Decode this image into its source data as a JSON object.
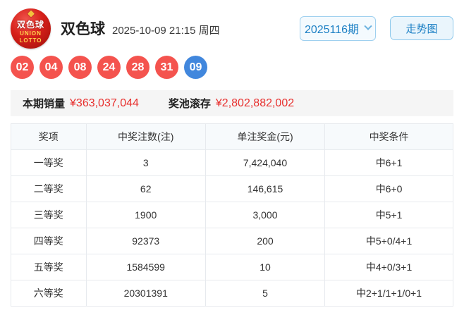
{
  "header": {
    "logo": {
      "line1": "双色球",
      "line2": "UNION",
      "line3": "LOTTO"
    },
    "title": "双色球",
    "datetime": "2025-10-09 21:15 周四",
    "issue_selector": "2025116期",
    "trend_button": "走势图"
  },
  "balls": {
    "red": [
      "02",
      "04",
      "08",
      "24",
      "28",
      "31"
    ],
    "blue": [
      "09"
    ]
  },
  "summary": {
    "sales_label": "本期销量",
    "sales_value": "¥363,037,044",
    "pool_label": "奖池滚存",
    "pool_value": "¥2,802,882,002"
  },
  "table": {
    "headers": [
      "奖项",
      "中奖注数(注)",
      "单注奖金(元)",
      "中奖条件"
    ],
    "rows": [
      [
        "一等奖",
        "3",
        "7,424,040",
        "中6+1"
      ],
      [
        "二等奖",
        "62",
        "146,615",
        "中6+0"
      ],
      [
        "三等奖",
        "1900",
        "3,000",
        "中5+1"
      ],
      [
        "四等奖",
        "92373",
        "200",
        "中5+0/4+1"
      ],
      [
        "五等奖",
        "1584599",
        "10",
        "中4+0/3+1"
      ],
      [
        "六等奖",
        "20301391",
        "5",
        "中2+1/1+1/0+1"
      ]
    ]
  },
  "colors": {
    "red_ball": "#f4534e",
    "blue_ball": "#4187dd",
    "amount_red": "#e8302e",
    "accent_blue": "#1b7fc4",
    "button_border": "#9fd0ef",
    "table_border": "#e7eaee",
    "table_header_bg": "#f7fafc",
    "summary_bg": "#f5f5f5"
  }
}
